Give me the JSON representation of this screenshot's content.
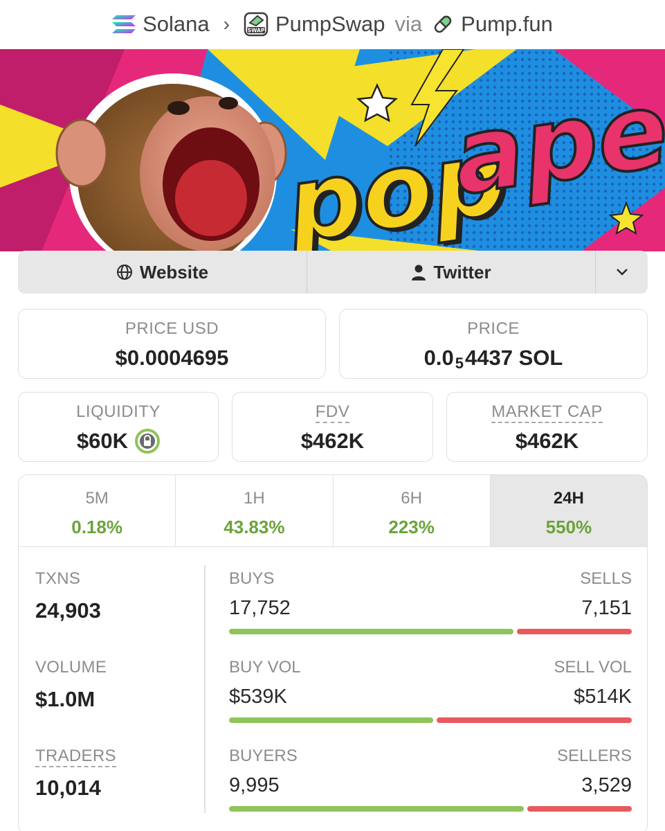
{
  "breadcrumb": {
    "chain": "Solana",
    "dex": "PumpSwap",
    "via": "via",
    "source": "Pump.fun",
    "dex_badge": "SWAP"
  },
  "banner": {
    "title_part1": "pop",
    "title_part2": "ape",
    "colors": {
      "pop": "#f6d21f",
      "ape": "#e8336b"
    }
  },
  "links": {
    "website": "Website",
    "twitter": "Twitter",
    "website_icon": "globe-icon",
    "twitter_icon": "person-icon",
    "more_icon": "chevron-down-icon"
  },
  "prices": {
    "price_usd_label": "PRICE USD",
    "price_usd_value": "$0.0004695",
    "price_label": "PRICE",
    "price_prefix": "0.0",
    "price_zero_count": "5",
    "price_suffix": "4437 SOL"
  },
  "metrics": {
    "liquidity_label": "LIQUIDITY",
    "liquidity_value": "$60K",
    "liquidity_icon": "lock-icon",
    "fdv_label": "FDV",
    "fdv_value": "$462K",
    "mcap_label": "MARKET CAP",
    "mcap_value": "$462K"
  },
  "timeframes": [
    {
      "label": "5M",
      "change": "0.18%"
    },
    {
      "label": "1H",
      "change": "43.83%"
    },
    {
      "label": "6H",
      "change": "223%"
    },
    {
      "label": "24H",
      "change": "550%"
    }
  ],
  "active_timeframe": "24H",
  "stats": {
    "txns_label": "TXNS",
    "txns_value": "24,903",
    "volume_label": "VOLUME",
    "volume_value": "$1.0M",
    "traders_label": "TRADERS",
    "traders_value": "10,014"
  },
  "breakdown": [
    {
      "left_label": "BUYS",
      "left_value": "17,752",
      "right_label": "SELLS",
      "right_value": "7,151",
      "buy_fraction": 0.713
    },
    {
      "left_label": "BUY VOL",
      "left_value": "$539K",
      "right_label": "SELL VOL",
      "right_value": "$514K",
      "buy_fraction": 0.512
    },
    {
      "left_label": "BUYERS",
      "left_value": "9,995",
      "right_label": "SELLERS",
      "right_value": "3,529",
      "buy_fraction": 0.739
    }
  ],
  "colors": {
    "positive": "#6ba33a",
    "buy_bar": "#8fc45a",
    "sell_bar": "#e85a5e"
  }
}
